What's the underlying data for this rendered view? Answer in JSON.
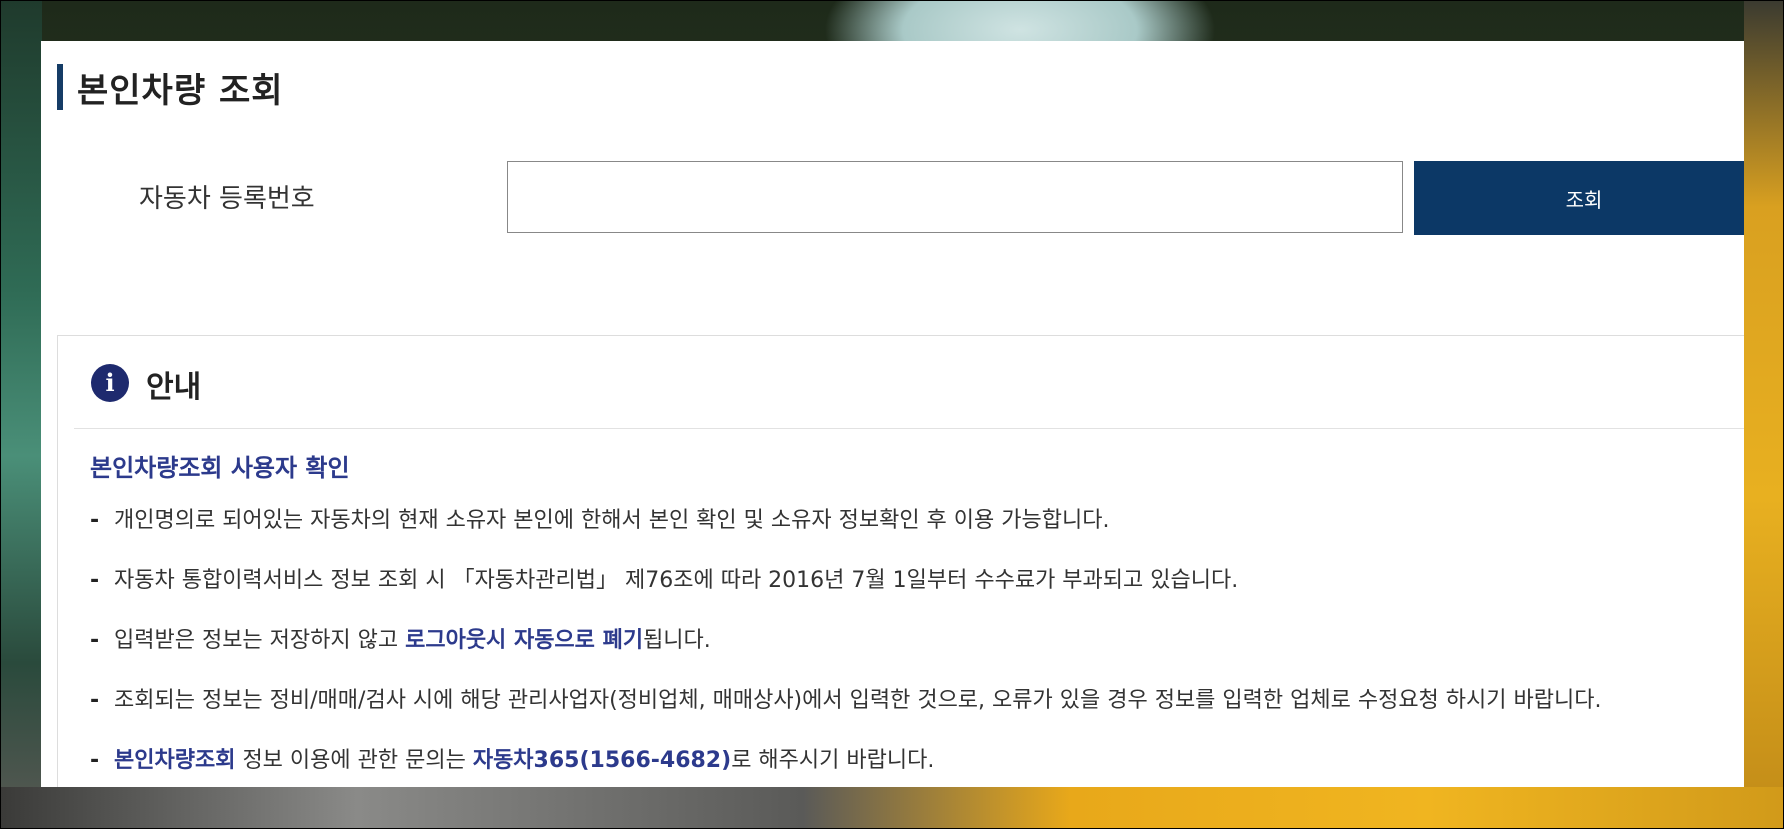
{
  "page": {
    "title": "본인차량 조회"
  },
  "search": {
    "label": "자동차 등록번호",
    "value": "",
    "placeholder": "",
    "button_label": "조회"
  },
  "info": {
    "title": "안내",
    "icon": "info-icon",
    "icon_glyph": "i",
    "subtitle": "본인차량조회 사용자 확인",
    "items": [
      {
        "parts": [
          {
            "text": "개인명의로 되어있는 자동차의 현재 소유자 본인에 한해서 본인 확인 및 소유자 정보확인 후 이용 가능합니다.",
            "highlight": false
          }
        ]
      },
      {
        "parts": [
          {
            "text": "자동차 통합이력서비스 정보 조회 시 「자동차관리법」 제76조에 따라 2016년 7월 1일부터 수수료가 부과되고 있습니다.",
            "highlight": false
          }
        ]
      },
      {
        "parts": [
          {
            "text": "입력받은 정보는 저장하지 않고 ",
            "highlight": false
          },
          {
            "text": "로그아웃시 자동으로 폐기",
            "highlight": true
          },
          {
            "text": "됩니다.",
            "highlight": false
          }
        ]
      },
      {
        "parts": [
          {
            "text": "조회되는 정보는 정비/매매/검사 시에 해당 관리사업자(정비업체, 매매상사)에서 입력한 것으로, 오류가 있을 경우 정보를 입력한 업체로 수정요청 하시기 바랍니다.",
            "highlight": false
          }
        ]
      },
      {
        "parts": [
          {
            "text": "본인차량조회",
            "highlight": true
          },
          {
            "text": " 정보 이용에 관한 문의는 ",
            "highlight": false
          },
          {
            "text": "자동차365(1566-4682)",
            "highlight": true
          },
          {
            "text": "로 해주시기 바랍니다.",
            "highlight": false
          }
        ]
      }
    ]
  },
  "colors": {
    "accent": "#0c3866",
    "highlight_text": "#2c3a8c",
    "info_icon_bg": "#1e2a6e"
  }
}
